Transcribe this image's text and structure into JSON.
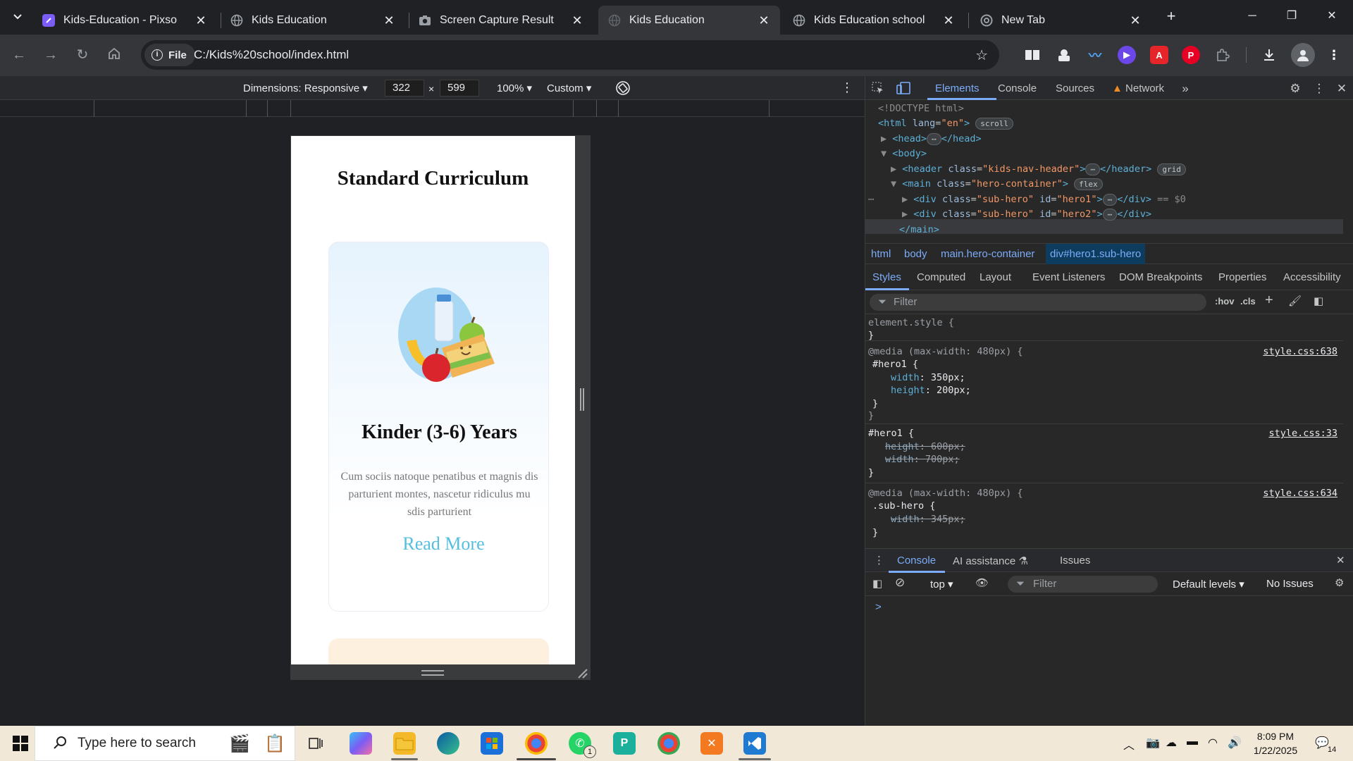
{
  "browser": {
    "tabs": [
      {
        "title": "Kids-Education - Pixso",
        "active": false,
        "favicon_color": "#7b5cf5"
      },
      {
        "title": "Kids Education",
        "active": false,
        "favicon_color": "#9aa0a6"
      },
      {
        "title": "Screen Capture Result",
        "active": false,
        "favicon_color": "#9aa0a6"
      },
      {
        "title": "Kids Education",
        "active": true,
        "favicon_color": "#9aa0a6"
      },
      {
        "title": "Kids Education school",
        "active": false,
        "favicon_color": "#9aa0a6"
      },
      {
        "title": "New Tab",
        "active": false,
        "favicon_color": "#9aa0a6"
      }
    ],
    "address": {
      "scheme_chip": "File",
      "url": "C:/Kids%20school/index.html"
    }
  },
  "device_toolbar": {
    "dimensions_label": "Dimensions: Responsive",
    "width": "322",
    "times": "×",
    "height": "599",
    "zoom": "100%",
    "throttle": "Custom"
  },
  "page": {
    "heading": "Standard Curriculum",
    "card": {
      "title": "Kinder (3-6) Years",
      "text": "Cum sociis natoque penatibus et magnis dis parturient montes, nascetur ridiculus mu sdis parturient",
      "link": "Read More"
    }
  },
  "devtools": {
    "tabs": [
      "Elements",
      "Console",
      "Sources",
      "Network"
    ],
    "active_tab": "Elements",
    "dom": {
      "doctype": "<!DOCTYPE html>",
      "html_open": "<html",
      "html_attr": "lang",
      "html_val": "\"en\"",
      "scroll_pill": "scroll",
      "head_open": "<head>",
      "head_close": "</head>",
      "body_open": "<body>",
      "header_open": "<header",
      "header_class": "\"kids-nav-header\"",
      "header_close": "</header>",
      "grid_pill": "grid",
      "main_open": "<main",
      "main_class": "\"hero-container\"",
      "flex_pill": "flex",
      "div_open": "<div",
      "div_class": "\"sub-hero\"",
      "div1_id": "\"hero1\"",
      "div2_id": "\"hero2\"",
      "div_close": "</div>",
      "eq0": "== $0",
      "main_close": "</main>"
    },
    "breadcrumbs": [
      "html",
      "body",
      "main.hero-container",
      "div#hero1.sub-hero"
    ],
    "style_tabs": [
      "Styles",
      "Computed",
      "Layout",
      "Event Listeners",
      "DOM Breakpoints",
      "Properties",
      "Accessibility"
    ],
    "filter_placeholder": "Filter",
    "hov": ":hov",
    "cls": ".cls",
    "rules": {
      "element_style": "element.style {",
      "close": "}",
      "media1": "@media (max-width: 480px) {",
      "media1_src": "style.css:638",
      "hero1_sel": "#hero1 {",
      "r1_p1": "width",
      "r1_v1": "350px;",
      "r1_p2": "height",
      "r1_v2": "200px;",
      "rule2_sel": "#hero1 {",
      "rule2_src": "style.css:33",
      "r2_p1": "height",
      "r2_v1": "600px;",
      "r2_p2": "width",
      "r2_v2": "700px;",
      "media2": "@media (max-width: 480px) {",
      "media2_src": "style.css:634",
      "subhero_sel": ".sub-hero {",
      "r3_p1": "width",
      "r3_v1": "345px;"
    },
    "drawer": {
      "tabs": [
        "Console",
        "AI assistance",
        "Issues"
      ],
      "context": "top",
      "filter_placeholder": "Filter",
      "levels": "Default levels",
      "issues": "No Issues",
      "prompt": ">"
    }
  },
  "taskbar": {
    "search_placeholder": "Type here to search",
    "time": "8:09 PM",
    "date": "1/22/2025",
    "notification_count": "14",
    "whatsapp_badge": "1"
  }
}
